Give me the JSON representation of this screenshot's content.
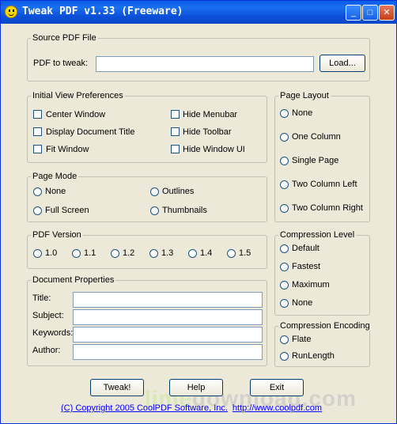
{
  "window": {
    "title": "Tweak PDF v1.33 (Freeware)",
    "minimize_glyph": "_",
    "maximize_glyph": "□",
    "close_glyph": "✕"
  },
  "source": {
    "legend": "Source PDF File",
    "label": "PDF to tweak:",
    "value": "",
    "load_button": "Load..."
  },
  "initial_view": {
    "legend": "Initial View Preferences",
    "options": [
      "Center Window",
      "Display Document Title",
      "Fit Window",
      "Hide Menubar",
      "Hide Toolbar",
      "Hide Window UI"
    ]
  },
  "page_mode": {
    "legend": "Page Mode",
    "options": [
      "None",
      "Outlines",
      "Full Screen",
      "Thumbnails"
    ]
  },
  "pdf_version": {
    "legend": "PDF Version",
    "options": [
      "1.0",
      "1.1",
      "1.2",
      "1.3",
      "1.4",
      "1.5"
    ]
  },
  "doc_props": {
    "legend": "Document Properties",
    "fields": [
      "Title:",
      "Subject:",
      "Keywords:",
      "Author:"
    ],
    "values": [
      "",
      "",
      "",
      ""
    ]
  },
  "page_layout": {
    "legend": "Page Layout",
    "options": [
      "None",
      "One Column",
      "Single Page",
      "Two Column Left",
      "Two Column Right"
    ]
  },
  "compression_level": {
    "legend": "Compression Level",
    "options": [
      "Default",
      "Fastest",
      "Maximum",
      "None"
    ]
  },
  "compression_encoding": {
    "legend": "Compression Encoding",
    "options": [
      "Flate",
      "RunLength"
    ]
  },
  "buttons": {
    "tweak": "Tweak!",
    "help": "Help",
    "exit": "Exit"
  },
  "footer": {
    "copyright": "(C) Copyright 2005 CoolPDF Software, Inc.",
    "url": "http://www.coolpdf.com"
  },
  "watermark": {
    "part1": "lime",
    "part2": "download.com"
  }
}
